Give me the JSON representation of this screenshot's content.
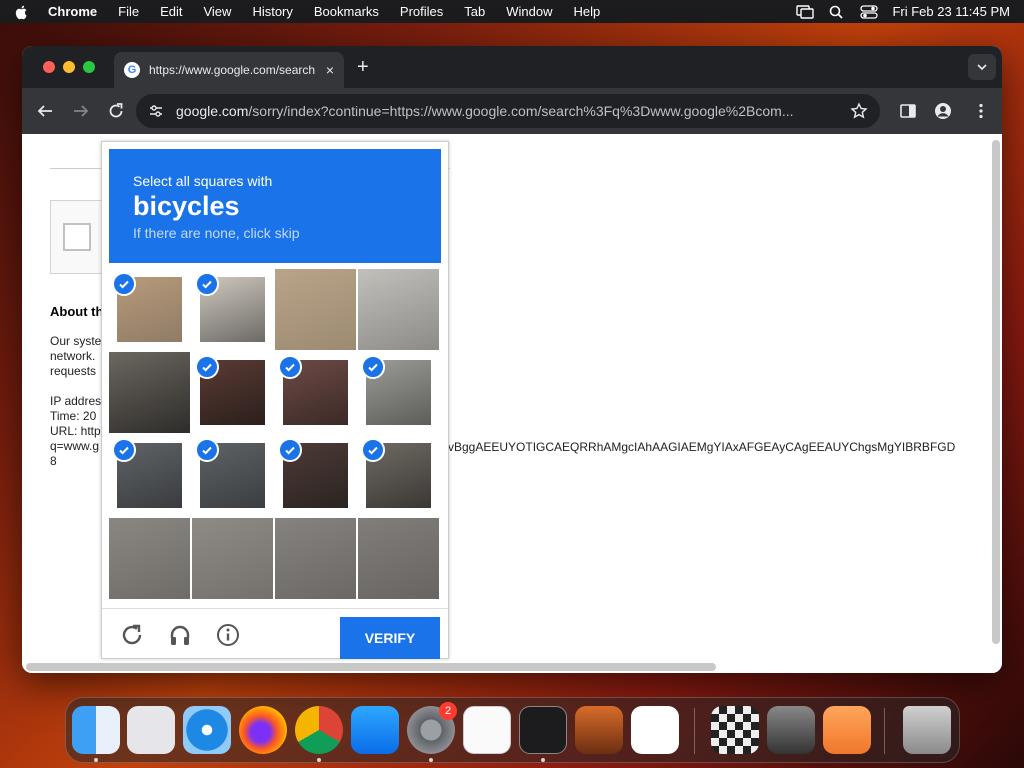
{
  "menubar": {
    "app_name": "Chrome",
    "items": [
      "File",
      "Edit",
      "View",
      "History",
      "Bookmarks",
      "Profiles",
      "Tab",
      "Window",
      "Help"
    ],
    "clock": "Fri Feb 23  11:45 PM"
  },
  "browser": {
    "tab_title": "https://www.google.com/search",
    "tab_close": "×",
    "new_tab": "+",
    "url_host": "google.com",
    "url_rest": "/sorry/index?continue=https://www.google.com/search%3Fq%3Dwww.google%2Bcom..."
  },
  "page": {
    "about_heading": "About th",
    "paragraph_lines": [
      "Our syste",
      "network.",
      "requests"
    ],
    "info_lines": [
      "IP addres",
      "Time: 20",
      "URL: http",
      "q=www.g",
      "8"
    ],
    "long_url_fragment": "vBggAEEUYOTIGCAEQRRhAMgcIAhAAGIAEMgYIAxAFGEAyCAgEEAUYChgsMgYIBRBFGD"
  },
  "captcha": {
    "instruction": "Select all squares with",
    "target": "bicycles",
    "hint": "If there are none, click skip",
    "verify_label": "VERIFY",
    "tiles": [
      {
        "selected": true
      },
      {
        "selected": true
      },
      {
        "selected": false
      },
      {
        "selected": false
      },
      {
        "selected": false
      },
      {
        "selected": true
      },
      {
        "selected": true
      },
      {
        "selected": true
      },
      {
        "selected": true
      },
      {
        "selected": true
      },
      {
        "selected": true
      },
      {
        "selected": true
      },
      {
        "selected": false
      },
      {
        "selected": false
      },
      {
        "selected": false
      },
      {
        "selected": false
      }
    ]
  },
  "dock": {
    "apps": [
      "finder-icon",
      "launchpad-icon",
      "safari-icon",
      "firefox-icon",
      "chrome-icon",
      "app-store-icon",
      "system-settings-icon",
      "textedit-icon",
      "terminal-icon",
      "garageband-icon",
      "vscode-icon",
      "chess-icon",
      "image-capture-icon",
      "keynote-icon",
      "trash-icon"
    ],
    "settings_badge": "2"
  },
  "colors": {
    "accent": "#1a73e8",
    "chrome_dark": "#35363a"
  }
}
